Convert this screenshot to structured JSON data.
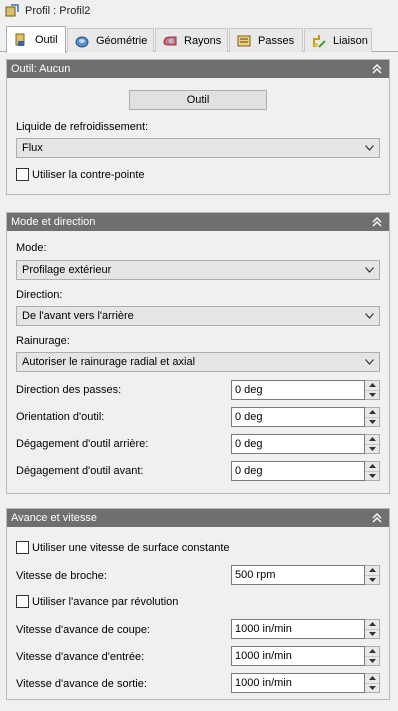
{
  "window": {
    "title": "Profil : Profil2"
  },
  "tabs": [
    {
      "label": "Outil",
      "icon": "tool-icon",
      "active": true
    },
    {
      "label": "Géométrie",
      "icon": "geometry-icon",
      "active": false
    },
    {
      "label": "Rayons",
      "icon": "radii-icon",
      "active": false
    },
    {
      "label": "Passes",
      "icon": "passes-icon",
      "active": false
    },
    {
      "label": "Liaison",
      "icon": "linking-icon",
      "active": false
    }
  ],
  "tool_panel": {
    "header": "Outil: Aucun",
    "tool_button": "Outil",
    "coolant_label": "Liquide de refroidissement:",
    "coolant_value": "Flux",
    "tailstock_checkbox": {
      "label": "Utiliser la contre-pointe",
      "checked": false
    }
  },
  "mode_panel": {
    "header": "Mode et direction",
    "mode_label": "Mode:",
    "mode_value": "Profilage extérieur",
    "direction_label": "Direction:",
    "direction_value": "De l'avant vers l'arrière",
    "grooving_label": "Rainurage:",
    "grooving_value": "Autoriser le rainurage radial et axial",
    "fields": [
      {
        "label": "Direction des passes:",
        "value": "0 deg"
      },
      {
        "label": "Orientation d'outil:",
        "value": "0 deg"
      },
      {
        "label": "Dégagement d'outil arrière:",
        "value": "0 deg"
      },
      {
        "label": "Dégagement d'outil avant:",
        "value": "0 deg"
      }
    ]
  },
  "feed_panel": {
    "header": "Avance et vitesse",
    "css_checkbox": {
      "label": "Utiliser une vitesse de surface constante",
      "checked": false
    },
    "spindle_label": "Vitesse de broche:",
    "spindle_value": "500 rpm",
    "feed_per_rev_checkbox": {
      "label": "Utiliser l'avance par révolution",
      "checked": false
    },
    "fields": [
      {
        "label": "Vitesse d'avance de coupe:",
        "value": "1000 in/min"
      },
      {
        "label": "Vitesse d'avance d'entrée:",
        "value": "1000 in/min"
      },
      {
        "label": "Vitesse d'avance de sortie:",
        "value": "1000 in/min"
      }
    ]
  },
  "colors": {
    "panel_header": "#6f6f6f",
    "background": "#f0f0f0",
    "tab_active": "#ffffff"
  }
}
